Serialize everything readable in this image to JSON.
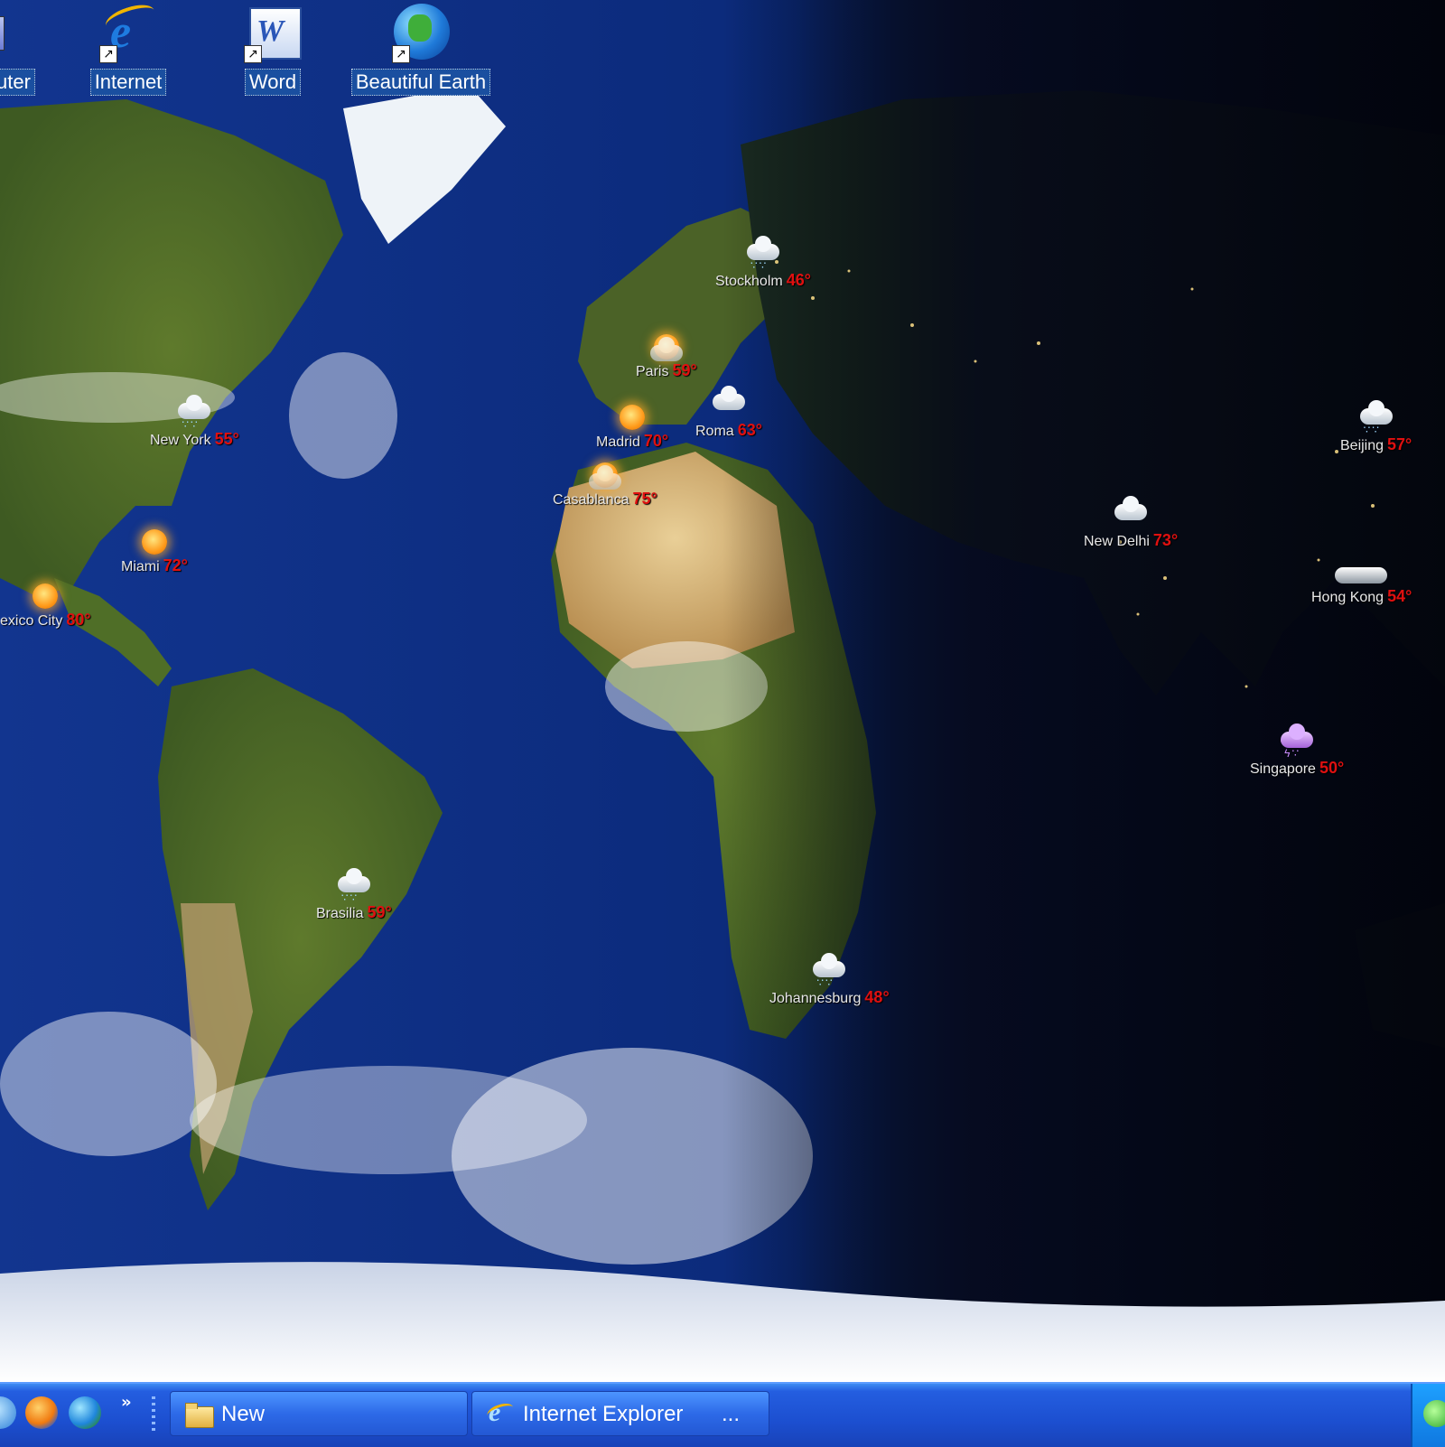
{
  "desktop": {
    "icons": [
      {
        "label": "uter",
        "icon": "my-computer-icon"
      },
      {
        "label": "Internet",
        "icon": "internet-explorer-icon"
      },
      {
        "label": "Word",
        "icon": "word-icon"
      },
      {
        "label": "Beautiful Earth",
        "icon": "globe-icon"
      }
    ]
  },
  "weather": {
    "cities": [
      {
        "name": "Stockholm",
        "temp": "46°",
        "condition": "snow-icon"
      },
      {
        "name": "Paris",
        "temp": "59°",
        "condition": "sun-cloud-icon"
      },
      {
        "name": "Roma",
        "temp": "63°",
        "condition": "cloudy-icon"
      },
      {
        "name": "Madrid",
        "temp": "70°",
        "condition": "sun-icon"
      },
      {
        "name": "New York",
        "temp": "55°",
        "condition": "snow-icon"
      },
      {
        "name": "Casablanca",
        "temp": "75°",
        "condition": "sun-cloud-icon"
      },
      {
        "name": "Miami",
        "temp": "72°",
        "condition": "sun-icon"
      },
      {
        "name": "exico City",
        "temp": "80°",
        "condition": "sun-icon"
      },
      {
        "name": "Beijing",
        "temp": "57°",
        "condition": "snow-icon"
      },
      {
        "name": "New Delhi",
        "temp": "73°",
        "condition": "cloudy-icon"
      },
      {
        "name": "Hong Kong",
        "temp": "54°",
        "condition": "overcast-icon"
      },
      {
        "name": "Singapore",
        "temp": "50°",
        "condition": "thunderstorm-icon"
      },
      {
        "name": "Brasilia",
        "temp": "59°",
        "condition": "rain-icon"
      },
      {
        "name": "Johannesburg",
        "temp": "48°",
        "condition": "rain-icon"
      }
    ]
  },
  "taskbar": {
    "quicklaunch": [
      "firefox-icon",
      "globe-icon"
    ],
    "chevron": "»",
    "buttons": [
      {
        "label": "New",
        "icon": "folder-icon"
      },
      {
        "label": "Internet Explorer",
        "icon": "internet-explorer-icon",
        "extra": "..."
      }
    ]
  },
  "colors": {
    "ocean": "#0b2a7a",
    "night": "#060a18",
    "taskbar": "#245ee0",
    "temperature": "#e01010"
  }
}
